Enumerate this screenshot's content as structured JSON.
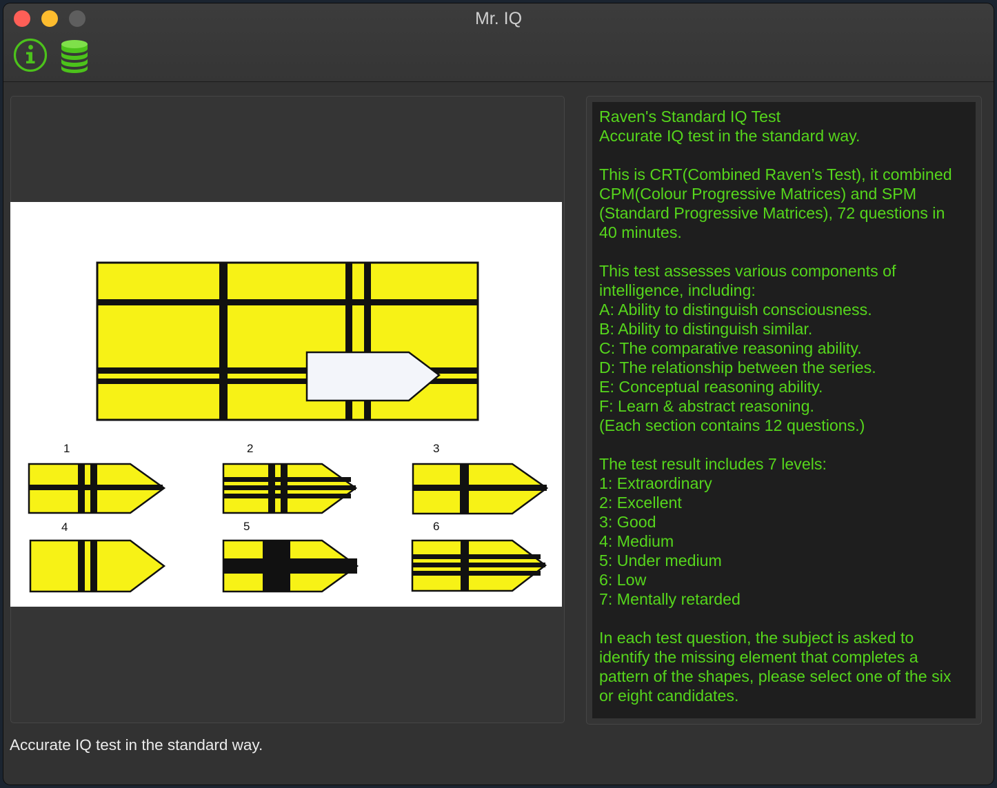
{
  "window": {
    "title": "Mr. IQ"
  },
  "toolbar": {
    "buttons": [
      {
        "icon": "info-icon",
        "color": "#4cc21b"
      },
      {
        "icon": "database-icon",
        "color": "#4cc21b"
      }
    ]
  },
  "puzzle": {
    "options": [
      "1",
      "2",
      "3",
      "4",
      "5",
      "6"
    ],
    "colors": {
      "fill": "#f7f216",
      "stripe": "#111111",
      "blank": "#f3f5fa"
    }
  },
  "description": {
    "color": "#56d61c",
    "paragraphs": [
      [
        "Raven's Standard IQ Test",
        "Accurate IQ test in the standard way."
      ],
      [
        "This is CRT(Combined Raven’s Test), it combined",
        "CPM(Colour Progressive Matrices) and SPM",
        "(Standard Progressive Matrices), 72 questions in",
        "40 minutes."
      ],
      [
        "This test assesses various components of",
        "intelligence, including:",
        "A: Ability to distinguish consciousness.",
        "B: Ability to distinguish similar.",
        "C: The comparative reasoning ability.",
        "D: The relationship between the series.",
        "E: Conceptual reasoning ability.",
        "F: Learn & abstract reasoning.",
        "(Each section contains 12 questions.)"
      ],
      [
        "The test result includes 7 levels:",
        "1: Extraordinary",
        "2: Excellent",
        "3: Good",
        "4: Medium",
        "5: Under medium",
        "6: Low",
        "7: Mentally retarded"
      ],
      [
        "In each test question, the subject is asked to",
        "identify the missing element that completes a",
        "pattern of the shapes, please select one of the six",
        "or eight candidates."
      ]
    ]
  },
  "status": {
    "text": "Accurate IQ test in the standard way."
  }
}
